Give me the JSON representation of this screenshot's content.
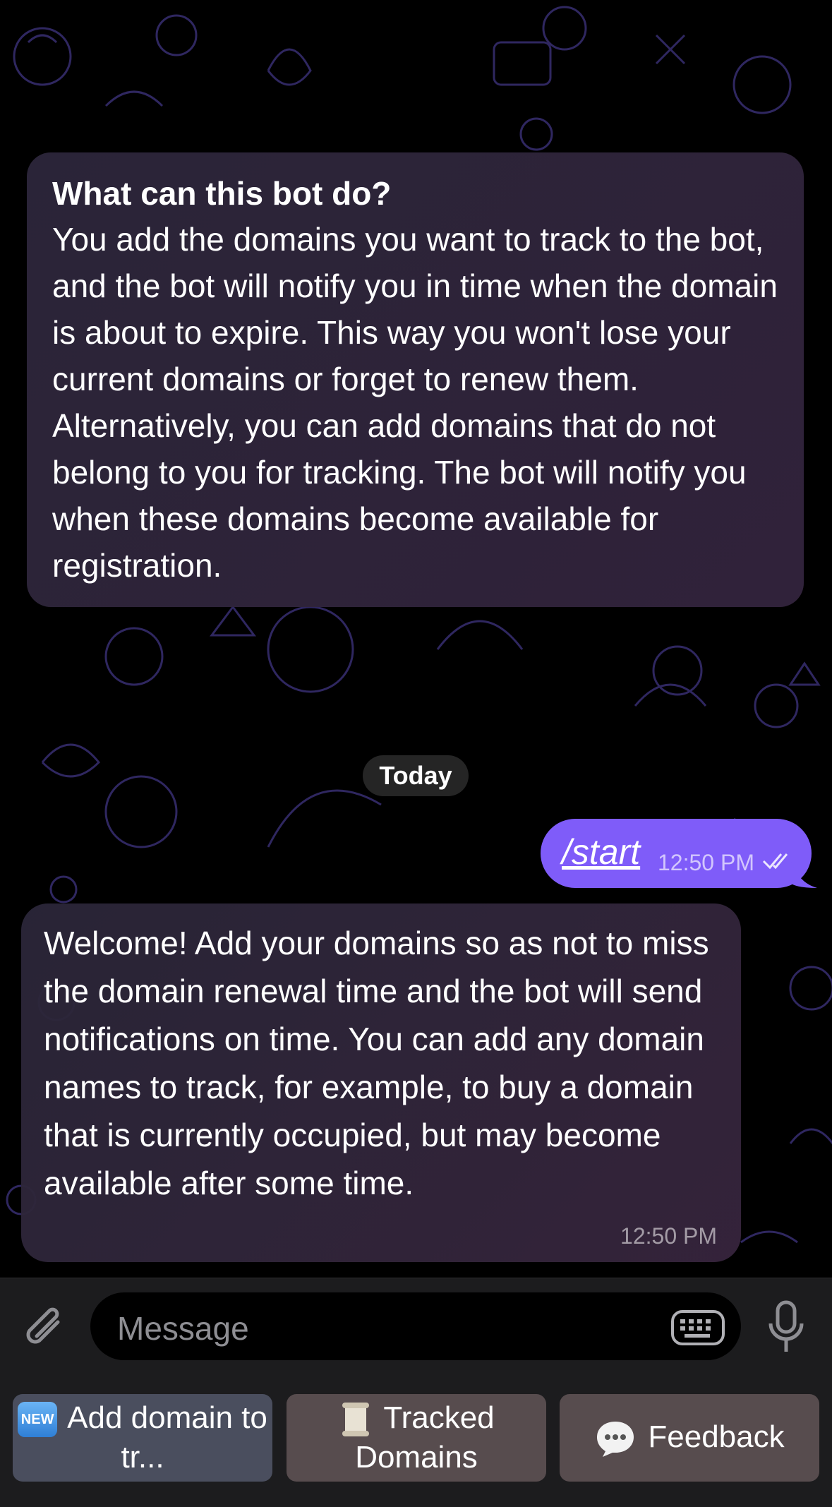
{
  "info": {
    "title": "What can this bot do?",
    "body": "You add the domains you want to track to the bot, and the bot will notify you in time when the domain is about to expire. This way you won't lose your current domains or forget to renew them. Alternatively, you can add domains that do not belong to you for tracking. The bot will notify you when these domains become available for registration."
  },
  "date_label": "Today",
  "outgoing": {
    "text": "/start",
    "time": "12:50 PM"
  },
  "incoming": {
    "text": "Welcome! Add your domains so as not to miss the domain renewal time and the bot will send notifications on time. You can add any domain names to track, for example, to buy a domain that is currently occupied, but may become available after some time.",
    "time": "12:50 PM"
  },
  "composer": {
    "placeholder": "Message"
  },
  "keyboard": {
    "add_badge": "NEW",
    "add_label": "Add domain to tr...",
    "tracked_label": "Tracked Domains",
    "feedback_label": "Feedback"
  },
  "colors": {
    "outgoing_bubble": "#7f5cf9",
    "pattern_stroke": "#3a2f6e"
  },
  "icons": [
    "paperclip-icon",
    "keyboard-icon",
    "microphone-icon",
    "new-badge-icon",
    "scroll-icon",
    "speech-bubble-icon",
    "double-check-icon"
  ]
}
